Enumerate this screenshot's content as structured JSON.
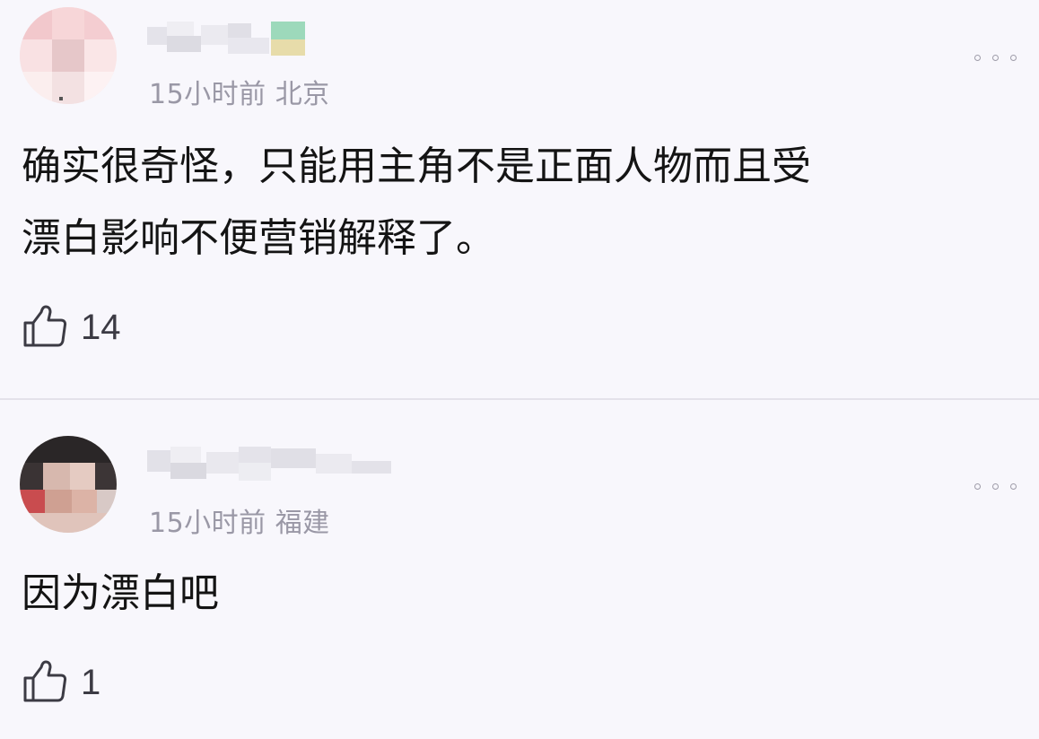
{
  "comments": [
    {
      "time": "15小时前",
      "location": "北京",
      "text_lines": [
        "确实很奇怪，只能用主角不是正面人物而且受",
        "漂白影响不便营销解释了。"
      ],
      "likes": "14"
    },
    {
      "time": "15小时前",
      "location": "福建",
      "text_lines": [
        "因为漂白吧"
      ],
      "likes": "1"
    }
  ],
  "icons": {
    "like": "thumbs-up-icon",
    "more": "more-dots-icon"
  },
  "colors": {
    "background": "#f8f7fc",
    "meta_text": "#9a98a6",
    "divider": "#e4e2ea"
  }
}
